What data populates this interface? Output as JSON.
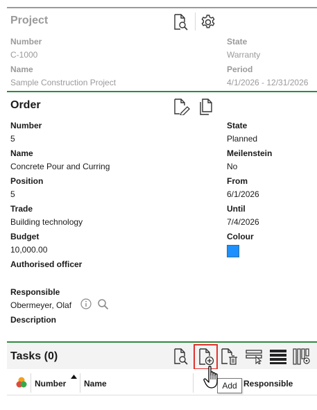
{
  "project": {
    "title": "Project",
    "number_label": "Number",
    "number_value": "C-1000",
    "state_label": "State",
    "state_value": "Warranty",
    "name_label": "Name",
    "name_value": "Sample Construction Project",
    "period_label": "Period",
    "period_value": "4/1/2026 - 12/31/2026"
  },
  "order": {
    "title": "Order",
    "number_label": "Number",
    "number_value": "5",
    "state_label": "State",
    "state_value": "Planned",
    "name_label": "Name",
    "name_value": "Concrete Pour and Curring",
    "milestone_label": "Meilenstein",
    "milestone_value": "No",
    "position_label": "Position",
    "position_value": "5",
    "from_label": "From",
    "from_value": "6/1/2026",
    "trade_label": "Trade",
    "trade_value": "Building technology",
    "until_label": "Until",
    "until_value": "7/4/2026",
    "budget_label": "Budget",
    "budget_value": "10,000.00",
    "colour_label": "Colour",
    "colour_value": "#1e90ff",
    "authorised_label": "Authorised officer",
    "responsible_label": "Responsible",
    "responsible_value": "Obermeyer, Olaf",
    "description_label": "Description"
  },
  "tasks": {
    "title": "Tasks (0)",
    "columns": {
      "number": "Number",
      "name": "Name",
      "responsible": "Responsible"
    },
    "tooltip": "Add"
  },
  "colors": {
    "accent_green": "#2e8b3e",
    "highlight_red": "#e0312e",
    "muted_text": "#9a9a9a"
  }
}
